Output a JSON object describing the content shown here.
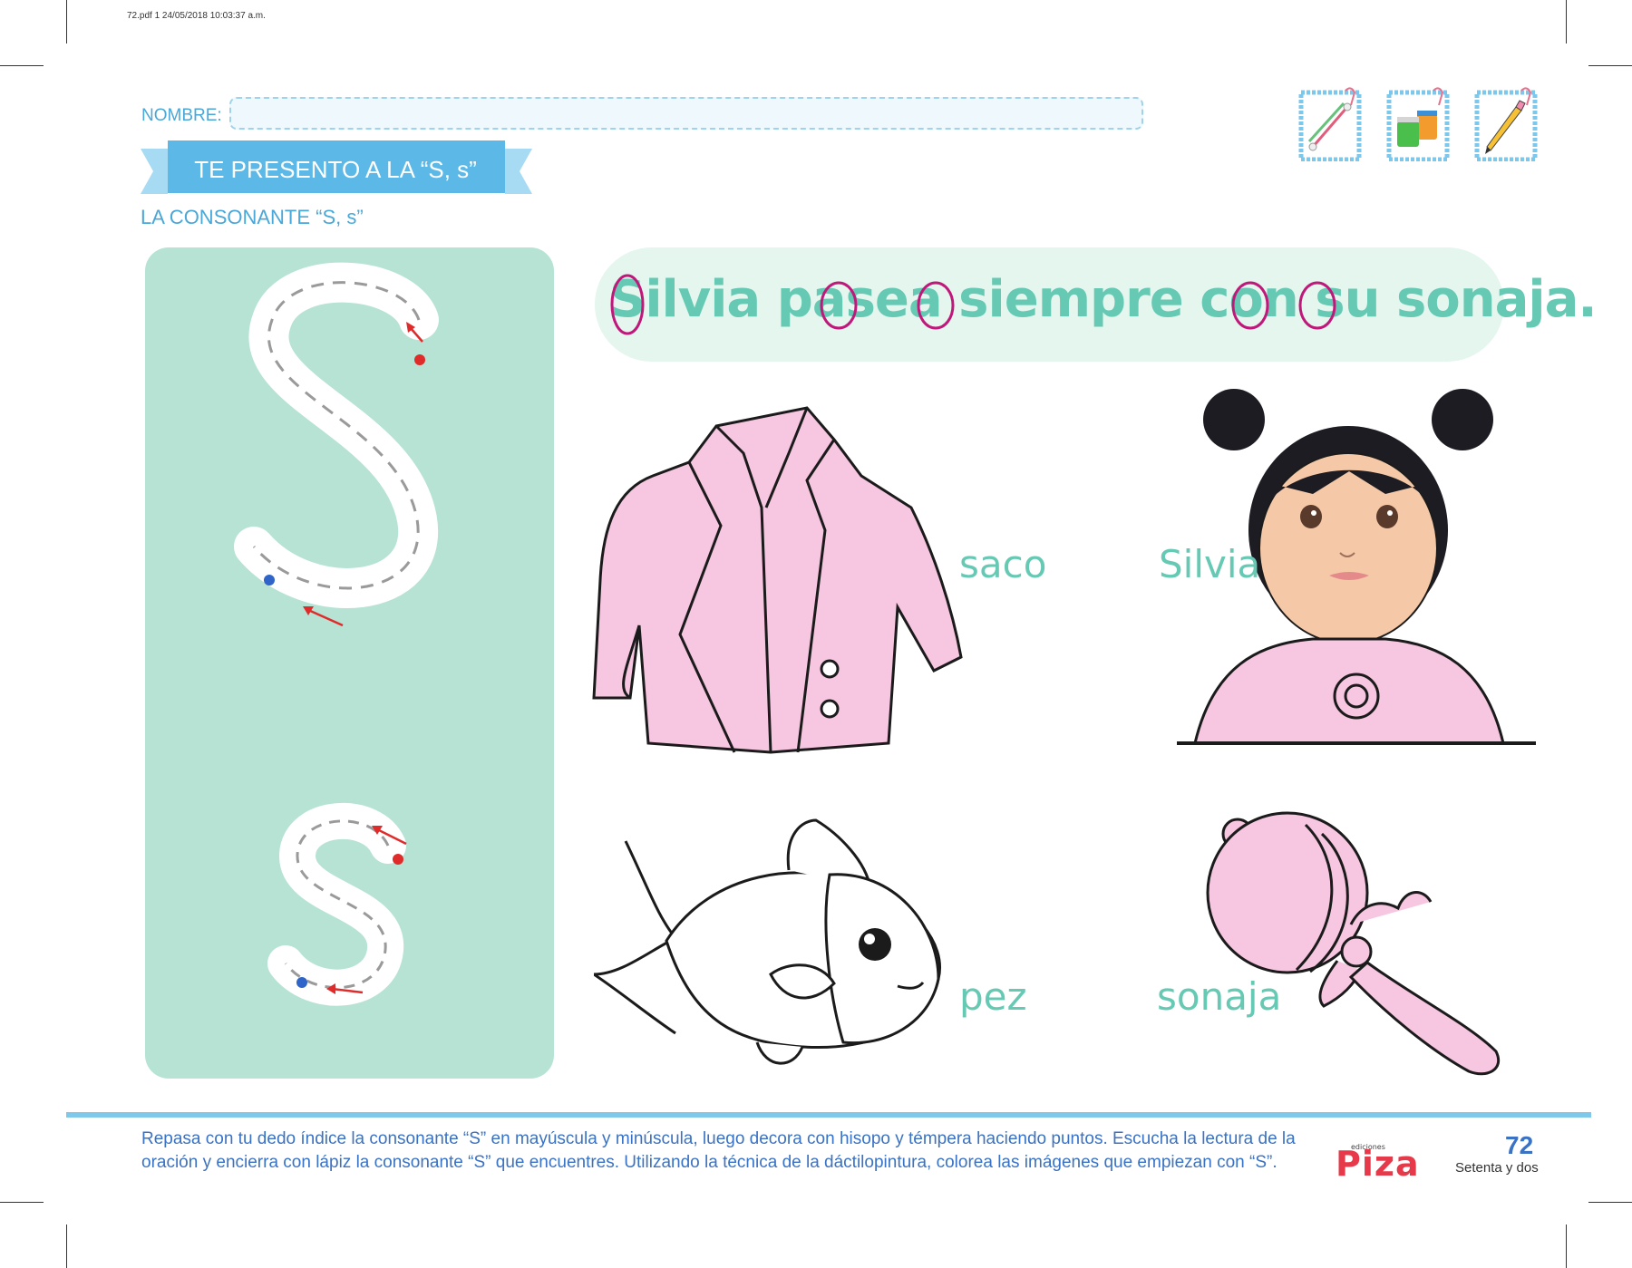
{
  "print_info": "72.pdf   1   24/05/2018   10:03:37 a.m.",
  "header": {
    "name_label": "NOMBRE:",
    "banner_title": "TE PRESENTO A LA “S, s”",
    "subtitle": "LA CONSONANTE “S, s”"
  },
  "tools": [
    "cotton-swabs-icon",
    "paint-jars-icon",
    "pencil-icon"
  ],
  "sentence": "Silvia pasea siempre con su sonaja.",
  "pictures": [
    {
      "word": "saco",
      "icon": "jacket-image"
    },
    {
      "word": "Silvia",
      "icon": "girl-image"
    },
    {
      "word": "pez",
      "icon": "fish-image"
    },
    {
      "word": "sonaja",
      "icon": "rattle-image"
    }
  ],
  "footer": {
    "instructions": "Repasa con tu dedo índice la consonante “S” en mayúscula y minúscula, luego decora con hisopo y témpera haciendo puntos. Escucha la lectura de la oración y encierra con lápiz la consonante “S” que encuentres. Utilizando la técnica de la dáctilopintura, colorea las imágenes que empiezan con “S”.",
    "brand_small": "ediciones",
    "brand": "Piza",
    "page_number": "72",
    "page_words": "Setenta y dos"
  },
  "colors": {
    "accent_blue": "#4aa8d8",
    "mint": "#b6e3d4",
    "teal_text": "#66c9b4",
    "pink_fill": "#f7c6e0",
    "circle_magenta": "#c0187a",
    "brand_red": "#e63a4a"
  }
}
